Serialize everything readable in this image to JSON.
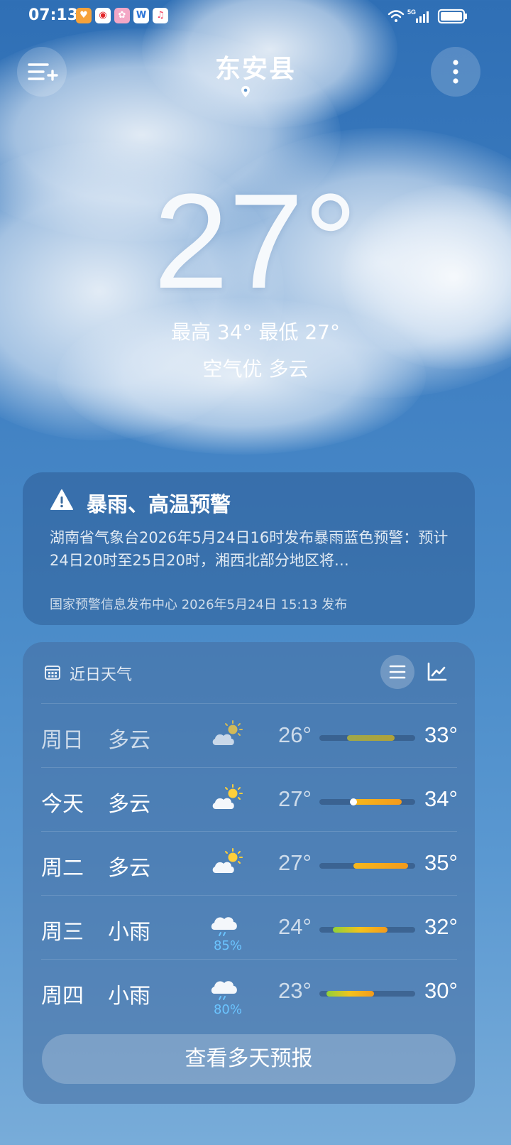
{
  "status_bar": {
    "time": "07:13",
    "apps": [
      "heart-app-icon",
      "weibo-icon",
      "cartoon-app-icon",
      "docs-app-icon",
      "music-app-icon"
    ],
    "network": "5G",
    "icons": [
      "wifi-icon",
      "signal-icon",
      "battery-icon"
    ]
  },
  "header": {
    "city": "东安县",
    "left_icon": "add-city-icon",
    "right_icon": "more-vertical-icon",
    "location_icon": "location-pin-icon"
  },
  "current": {
    "temperature": "27°",
    "hilo": "最高 34° 最低 27°",
    "condition": "空气优  多云"
  },
  "alert": {
    "title": "暴雨、高温预警",
    "text": "湖南省气象台2026年5月24日16时发布暴雨蓝色预警：预计24日20时至25日20时，湘西北部分地区将…",
    "source": "国家预警信息发布中心 2026年5月24日 15:13 发布",
    "icon": "warning-icon"
  },
  "forecast": {
    "title": "近日天气",
    "scale": {
      "min": 22,
      "max": 36
    },
    "days": [
      {
        "day": "周日",
        "cond": "多云",
        "icon": "partly-cloudy-icon",
        "pop": "",
        "low": "26°",
        "high": "33°",
        "low_v": 26,
        "high_v": 33,
        "current": null,
        "past": true
      },
      {
        "day": "今天",
        "cond": "多云",
        "icon": "partly-cloudy-icon",
        "pop": "",
        "low": "27°",
        "high": "34°",
        "low_v": 27,
        "high_v": 34,
        "current": 27,
        "past": false
      },
      {
        "day": "周二",
        "cond": "多云",
        "icon": "partly-cloudy-icon",
        "pop": "",
        "low": "27°",
        "high": "35°",
        "low_v": 27,
        "high_v": 35,
        "current": null,
        "past": false
      },
      {
        "day": "周三",
        "cond": "小雨",
        "icon": "light-rain-icon",
        "pop": "85%",
        "low": "24°",
        "high": "32°",
        "low_v": 24,
        "high_v": 32,
        "current": null,
        "past": false
      },
      {
        "day": "周四",
        "cond": "小雨",
        "icon": "light-rain-icon",
        "pop": "80%",
        "low": "23°",
        "high": "30°",
        "low_v": 23,
        "high_v": 30,
        "current": null,
        "past": false
      }
    ],
    "more_label": "查看多天预报"
  }
}
